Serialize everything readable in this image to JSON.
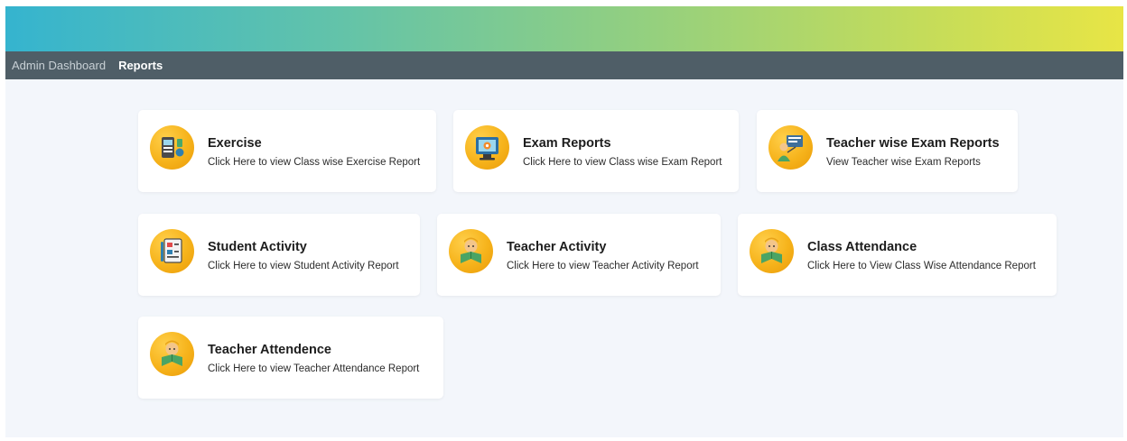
{
  "nav": {
    "items": [
      {
        "label": "Admin Dashboard"
      },
      {
        "label": "Reports"
      }
    ]
  },
  "cards": [
    {
      "title": "Exercise",
      "description": "Click Here to view Class wise Exercise Report",
      "icon": "exercise-icon"
    },
    {
      "title": "Exam Reports",
      "description": "Click Here to view Class wise Exam Report",
      "icon": "exam-report-icon"
    },
    {
      "title": "Teacher wise Exam Reports",
      "description": "View Teacher wise Exam Reports",
      "icon": "teacher-exam-icon"
    },
    {
      "title": "Student Activity",
      "description": "Click Here to view Student Activity Report",
      "icon": "student-activity-icon"
    },
    {
      "title": "Teacher Activity",
      "description": "Click Here to view Teacher Activity Report",
      "icon": "teacher-activity-icon"
    },
    {
      "title": "Class Attendance",
      "description": "Click Here to View Class Wise Attendance Report",
      "icon": "class-attendance-icon"
    },
    {
      "title": "Teacher Attendence",
      "description": "Click Here to view Teacher Attendance Report",
      "icon": "teacher-attendance-icon"
    }
  ],
  "colors": {
    "banner_start": "#35b4cf",
    "banner_end": "#e8e545",
    "navbar": "#4f5e67",
    "page_bg": "#f3f6fb",
    "icon_circle": "#f6b31b"
  }
}
